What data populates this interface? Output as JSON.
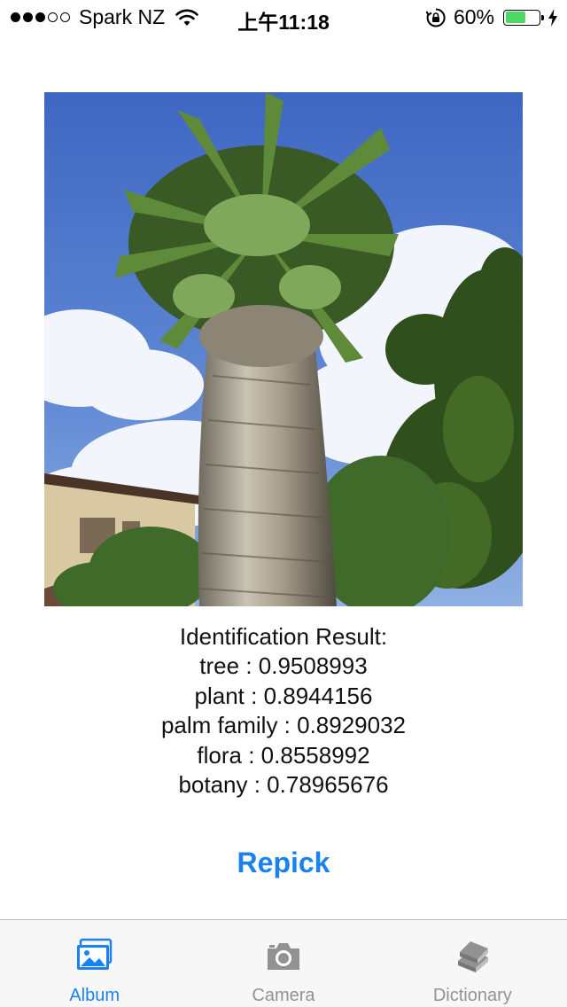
{
  "status_bar": {
    "carrier": "Spark NZ",
    "time": "上午11:18",
    "battery_text": "60%",
    "battery_level": 0.6,
    "signal_bars_filled": 3,
    "signal_bars_total": 5
  },
  "photo": {
    "icon": "palm-tree-photo"
  },
  "result": {
    "heading": "Identification Result:",
    "items": [
      {
        "label": "tree",
        "score": "0.9508993",
        "text": "tree : 0.9508993"
      },
      {
        "label": "plant",
        "score": "0.8944156",
        "text": "plant : 0.8944156"
      },
      {
        "label": "palm family",
        "score": "0.8929032",
        "text": "palm family : 0.8929032"
      },
      {
        "label": "flora",
        "score": "0.8558992",
        "text": "flora : 0.8558992"
      },
      {
        "label": "botany",
        "score": "0.78965676",
        "text": "botany : 0.78965676"
      }
    ]
  },
  "actions": {
    "repick_label": "Repick"
  },
  "tabs": [
    {
      "label": "Album",
      "icon": "album-icon",
      "active": true
    },
    {
      "label": "Camera",
      "icon": "camera-icon",
      "active": false
    },
    {
      "label": "Dictionary",
      "icon": "dictionary-icon",
      "active": false
    }
  ],
  "colors": {
    "accent": "#1a82f0",
    "inactive_tab": "#929292",
    "battery": "#4cd964",
    "tab_bar_bg": "#f7f7f7"
  }
}
